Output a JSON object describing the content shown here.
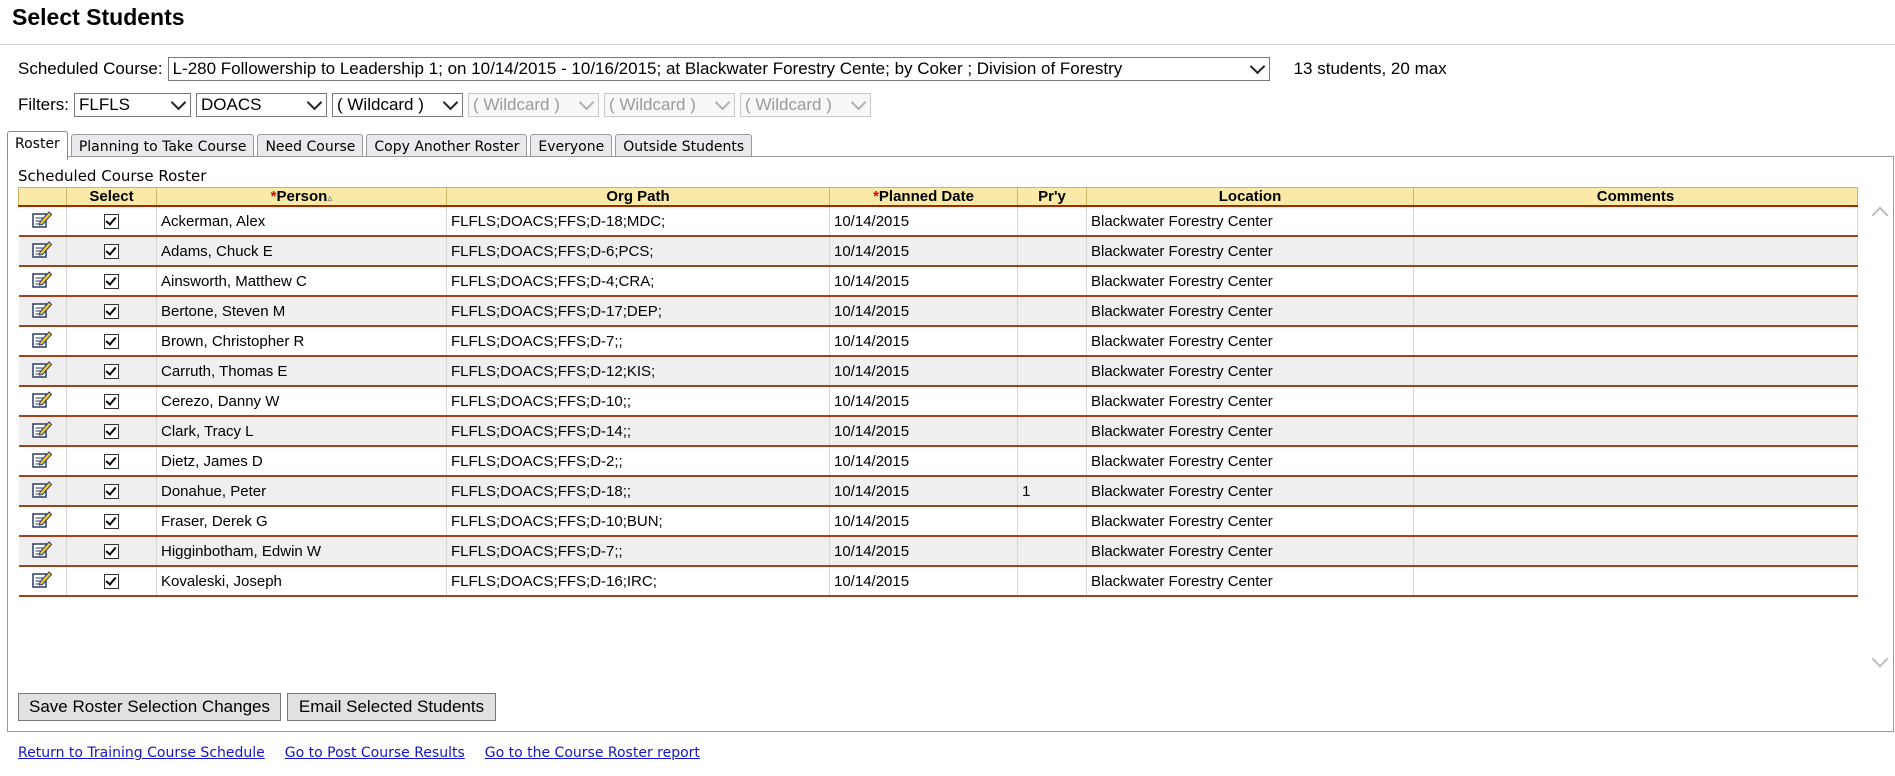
{
  "title": "Select Students",
  "course": {
    "label": "Scheduled Course:",
    "value": "L-280 Followership to Leadership 1; on 10/14/2015 - 10/16/2015; at Blackwater Forestry Cente; by Coker ; Division of Forestry",
    "count": "13 students, 20 max"
  },
  "filters": {
    "label": "Filters:",
    "values": [
      "FLFLS",
      "DOACS",
      "( Wildcard )",
      "( Wildcard )",
      "( Wildcard )",
      "( Wildcard )"
    ]
  },
  "tabs": [
    "Roster",
    "Planning to Take Course",
    "Need Course",
    "Copy Another Roster",
    "Everyone",
    "Outside Students"
  ],
  "roster": {
    "caption": "Scheduled Course Roster",
    "columns": {
      "select": "Select",
      "person": "Person",
      "org_path": "Org Path",
      "planned_date": "Planned Date",
      "priority": "Pr'y",
      "location": "Location",
      "comments": "Comments"
    },
    "rows": [
      {
        "person": "Ackerman, Alex",
        "org_path": "FLFLS;DOACS;FFS;D-18;MDC;",
        "planned_date": "10/14/2015",
        "priority": "",
        "location": "Blackwater Forestry Center",
        "comments": ""
      },
      {
        "person": "Adams, Chuck E",
        "org_path": "FLFLS;DOACS;FFS;D-6;PCS;",
        "planned_date": "10/14/2015",
        "priority": "",
        "location": "Blackwater Forestry Center",
        "comments": ""
      },
      {
        "person": "Ainsworth, Matthew C",
        "org_path": "FLFLS;DOACS;FFS;D-4;CRA;",
        "planned_date": "10/14/2015",
        "priority": "",
        "location": "Blackwater Forestry Center",
        "comments": ""
      },
      {
        "person": "Bertone, Steven M",
        "org_path": "FLFLS;DOACS;FFS;D-17;DEP;",
        "planned_date": "10/14/2015",
        "priority": "",
        "location": "Blackwater Forestry Center",
        "comments": ""
      },
      {
        "person": "Brown, Christopher R",
        "org_path": "FLFLS;DOACS;FFS;D-7;;",
        "planned_date": "10/14/2015",
        "priority": "",
        "location": "Blackwater Forestry Center",
        "comments": ""
      },
      {
        "person": "Carruth, Thomas E",
        "org_path": "FLFLS;DOACS;FFS;D-12;KIS;",
        "planned_date": "10/14/2015",
        "priority": "",
        "location": "Blackwater Forestry Center",
        "comments": ""
      },
      {
        "person": "Cerezo, Danny W",
        "org_path": "FLFLS;DOACS;FFS;D-10;;",
        "planned_date": "10/14/2015",
        "priority": "",
        "location": "Blackwater Forestry Center",
        "comments": ""
      },
      {
        "person": "Clark, Tracy L",
        "org_path": "FLFLS;DOACS;FFS;D-14;;",
        "planned_date": "10/14/2015",
        "priority": "",
        "location": "Blackwater Forestry Center",
        "comments": ""
      },
      {
        "person": "Dietz, James D",
        "org_path": "FLFLS;DOACS;FFS;D-2;;",
        "planned_date": "10/14/2015",
        "priority": "",
        "location": "Blackwater Forestry Center",
        "comments": ""
      },
      {
        "person": "Donahue, Peter",
        "org_path": "FLFLS;DOACS;FFS;D-18;;",
        "planned_date": "10/14/2015",
        "priority": "1",
        "location": "Blackwater Forestry Center",
        "comments": ""
      },
      {
        "person": "Fraser, Derek G",
        "org_path": "FLFLS;DOACS;FFS;D-10;BUN;",
        "planned_date": "10/14/2015",
        "priority": "",
        "location": "Blackwater Forestry Center",
        "comments": ""
      },
      {
        "person": "Higginbotham, Edwin W",
        "org_path": "FLFLS;DOACS;FFS;D-7;;",
        "planned_date": "10/14/2015",
        "priority": "",
        "location": "Blackwater Forestry Center",
        "comments": ""
      },
      {
        "person": "Kovaleski, Joseph",
        "org_path": "FLFLS;DOACS;FFS;D-16;IRC;",
        "planned_date": "10/14/2015",
        "priority": "",
        "location": "Blackwater Forestry Center",
        "comments": ""
      }
    ]
  },
  "buttons": {
    "save": "Save Roster Selection Changes",
    "email": "Email Selected Students"
  },
  "links": [
    "Return to Training Course Schedule",
    "Go to Post Course Results",
    "Go to the Course Roster report"
  ],
  "icons": {
    "edit": "edit-icon",
    "checkbox": "checkbox-checked-icon"
  },
  "colors": {
    "header_bg": "#fbe9a8",
    "row_rule": "#a0421c",
    "link": "#1515c8",
    "required": "#dd0000"
  }
}
